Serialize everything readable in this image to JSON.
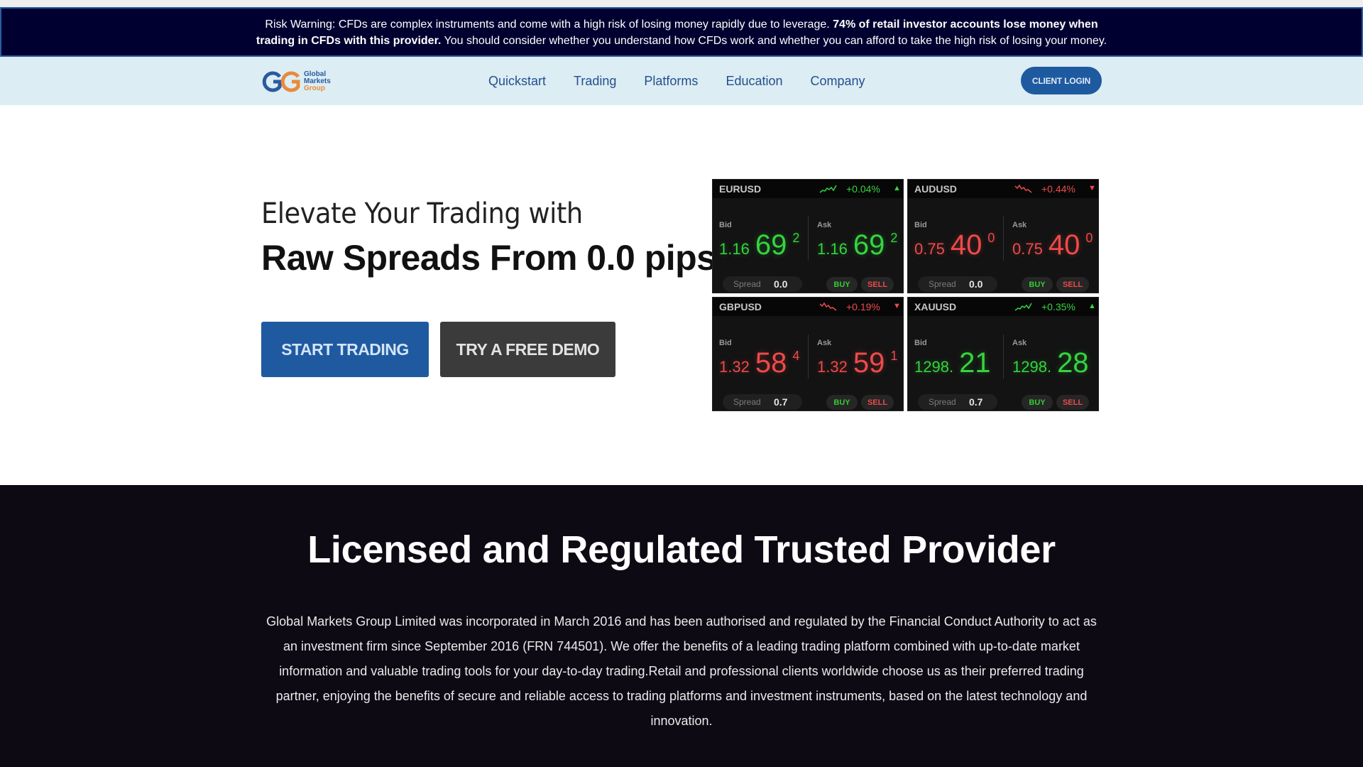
{
  "risk_banner": {
    "text_start": "Risk Warning: CFDs are complex instruments and come with a high risk of losing money rapidly due to leverage.",
    "text_bold": "74% of retail investor accounts lose money when trading in CFDs with this provider.",
    "text_end": "You should consider whether you understand how CFDs work and whether you can afford to take the high risk of losing your money."
  },
  "nav": {
    "logo": {
      "line1": "Global",
      "line2": "Markets",
      "line3": "Group"
    },
    "links": [
      "Quickstart",
      "Trading",
      "Platforms",
      "Education",
      "Company"
    ],
    "login_label": "CLIENT LOGIN"
  },
  "hero": {
    "subtitle": "Elevate Your Trading with",
    "title": "Raw Spreads From 0.0 pips",
    "start_label": "START TRADING",
    "demo_label": "TRY A FREE DEMO"
  },
  "quotes": [
    {
      "symbol": "EURUSD",
      "change": "+0.04%",
      "direction": "up",
      "color": "green",
      "bid_label": "Bid",
      "ask_label": "Ask",
      "bid": {
        "small": "1.16",
        "big": "69",
        "sup": "2"
      },
      "ask": {
        "small": "1.16",
        "big": "69",
        "sup": "2"
      },
      "spread_label": "Spread",
      "spread": "0.0",
      "buy_label": "BUY",
      "sell_label": "SELL"
    },
    {
      "symbol": "AUDUSD",
      "change": "+0.44%",
      "direction": "down",
      "color": "red",
      "bid_label": "Bid",
      "ask_label": "Ask",
      "bid": {
        "small": "0.75",
        "big": "40",
        "sup": "0"
      },
      "ask": {
        "small": "0.75",
        "big": "40",
        "sup": "0"
      },
      "spread_label": "Spread",
      "spread": "0.0",
      "buy_label": "BUY",
      "sell_label": "SELL"
    },
    {
      "symbol": "GBPUSD",
      "change": "+0.19%",
      "direction": "down",
      "color": "red",
      "bid_label": "Bid",
      "ask_label": "Ask",
      "bid": {
        "small": "1.32",
        "big": "58",
        "sup": "4"
      },
      "ask": {
        "small": "1.32",
        "big": "59",
        "sup": "1"
      },
      "spread_label": "Spread",
      "spread": "0.7",
      "buy_label": "BUY",
      "sell_label": "SELL"
    },
    {
      "symbol": "XAUUSD",
      "change": "+0.35%",
      "direction": "up",
      "color": "green",
      "bid_label": "Bid",
      "ask_label": "Ask",
      "bid": {
        "small": "1298.",
        "big": "21",
        "sup": ""
      },
      "ask": {
        "small": "1298.",
        "big": "28",
        "sup": ""
      },
      "spread_label": "Spread",
      "spread": "0.7",
      "buy_label": "BUY",
      "sell_label": "SELL"
    }
  ],
  "regulated": {
    "heading": "Licensed and Regulated Trusted Provider",
    "body": "Global Markets Group Limited was incorporated in March 2016 and has been authorised and regulated by the Financial Conduct Authority to act as an investment firm since September 2016 (FRN 744501). We offer the benefits of a leading trading platform combined with up-to-date market information and valuable trading tools for your day-to-day trading.Retail and professional clients worldwide choose us as their preferred trading partner, enjoying the benefits of secure and reliable access to trading platforms and investment instruments, based on the latest technology and innovation."
  },
  "colors": {
    "up": "#34d43f",
    "down": "#ee4a4a",
    "brand_blue": "#1f5aa0",
    "brand_orange": "#e98a3c"
  }
}
